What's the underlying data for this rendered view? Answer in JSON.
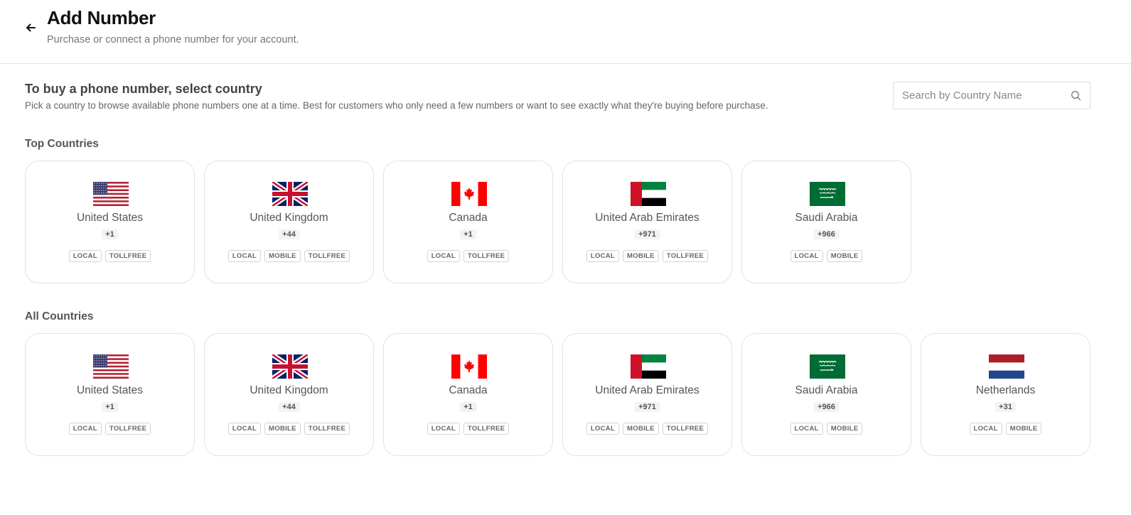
{
  "header": {
    "title": "Add Number",
    "subtitle": "Purchase or connect a phone number for your account."
  },
  "intro": {
    "title": "To buy a phone number, select country",
    "description": "Pick a country to browse available phone numbers one at a time. Best for customers who only need a few numbers or want to see exactly what they're buying before purchase."
  },
  "search": {
    "placeholder": "Search by Country Name",
    "value": ""
  },
  "top_countries": {
    "title": "Top Countries",
    "items": [
      {
        "name": "United States",
        "code": "+1",
        "flag": "us-flag-icon",
        "tags": [
          "LOCAL",
          "TOLLFREE"
        ]
      },
      {
        "name": "United Kingdom",
        "code": "+44",
        "flag": "uk-flag-icon",
        "tags": [
          "LOCAL",
          "MOBILE",
          "TOLLFREE"
        ]
      },
      {
        "name": "Canada",
        "code": "+1",
        "flag": "canada-flag-icon",
        "tags": [
          "LOCAL",
          "TOLLFREE"
        ]
      },
      {
        "name": "United Arab Emirates",
        "code": "+971",
        "flag": "uae-flag-icon",
        "tags": [
          "LOCAL",
          "MOBILE",
          "TOLLFREE"
        ]
      },
      {
        "name": "Saudi Arabia",
        "code": "+966",
        "flag": "saudi-flag-icon",
        "tags": [
          "LOCAL",
          "MOBILE"
        ]
      }
    ]
  },
  "all_countries": {
    "title": "All Countries",
    "items": [
      {
        "name": "United States",
        "code": "+1",
        "flag": "us-flag-icon",
        "tags": [
          "LOCAL",
          "TOLLFREE"
        ]
      },
      {
        "name": "United Kingdom",
        "code": "+44",
        "flag": "uk-flag-icon",
        "tags": [
          "LOCAL",
          "MOBILE",
          "TOLLFREE"
        ]
      },
      {
        "name": "Canada",
        "code": "+1",
        "flag": "canada-flag-icon",
        "tags": [
          "LOCAL",
          "TOLLFREE"
        ]
      },
      {
        "name": "United Arab Emirates",
        "code": "+971",
        "flag": "uae-flag-icon",
        "tags": [
          "LOCAL",
          "MOBILE",
          "TOLLFREE"
        ]
      },
      {
        "name": "Saudi Arabia",
        "code": "+966",
        "flag": "saudi-flag-icon",
        "tags": [
          "LOCAL",
          "MOBILE"
        ]
      },
      {
        "name": "Netherlands",
        "code": "+31",
        "flag": "netherlands-flag-icon",
        "tags": [
          "LOCAL",
          "MOBILE"
        ]
      }
    ]
  },
  "colors": {
    "border": "#e3e3e3",
    "text_muted": "#777777",
    "usa_red": "#b22234",
    "usa_blue": "#3c3b6e",
    "uk_blue": "#012169",
    "uk_red": "#c8102e",
    "canada_red": "#ff0000",
    "uae_red": "#ce1126",
    "uae_green": "#00843d",
    "saudi_green": "#006c35",
    "nl_red": "#ae1c28",
    "nl_blue": "#21468b"
  }
}
